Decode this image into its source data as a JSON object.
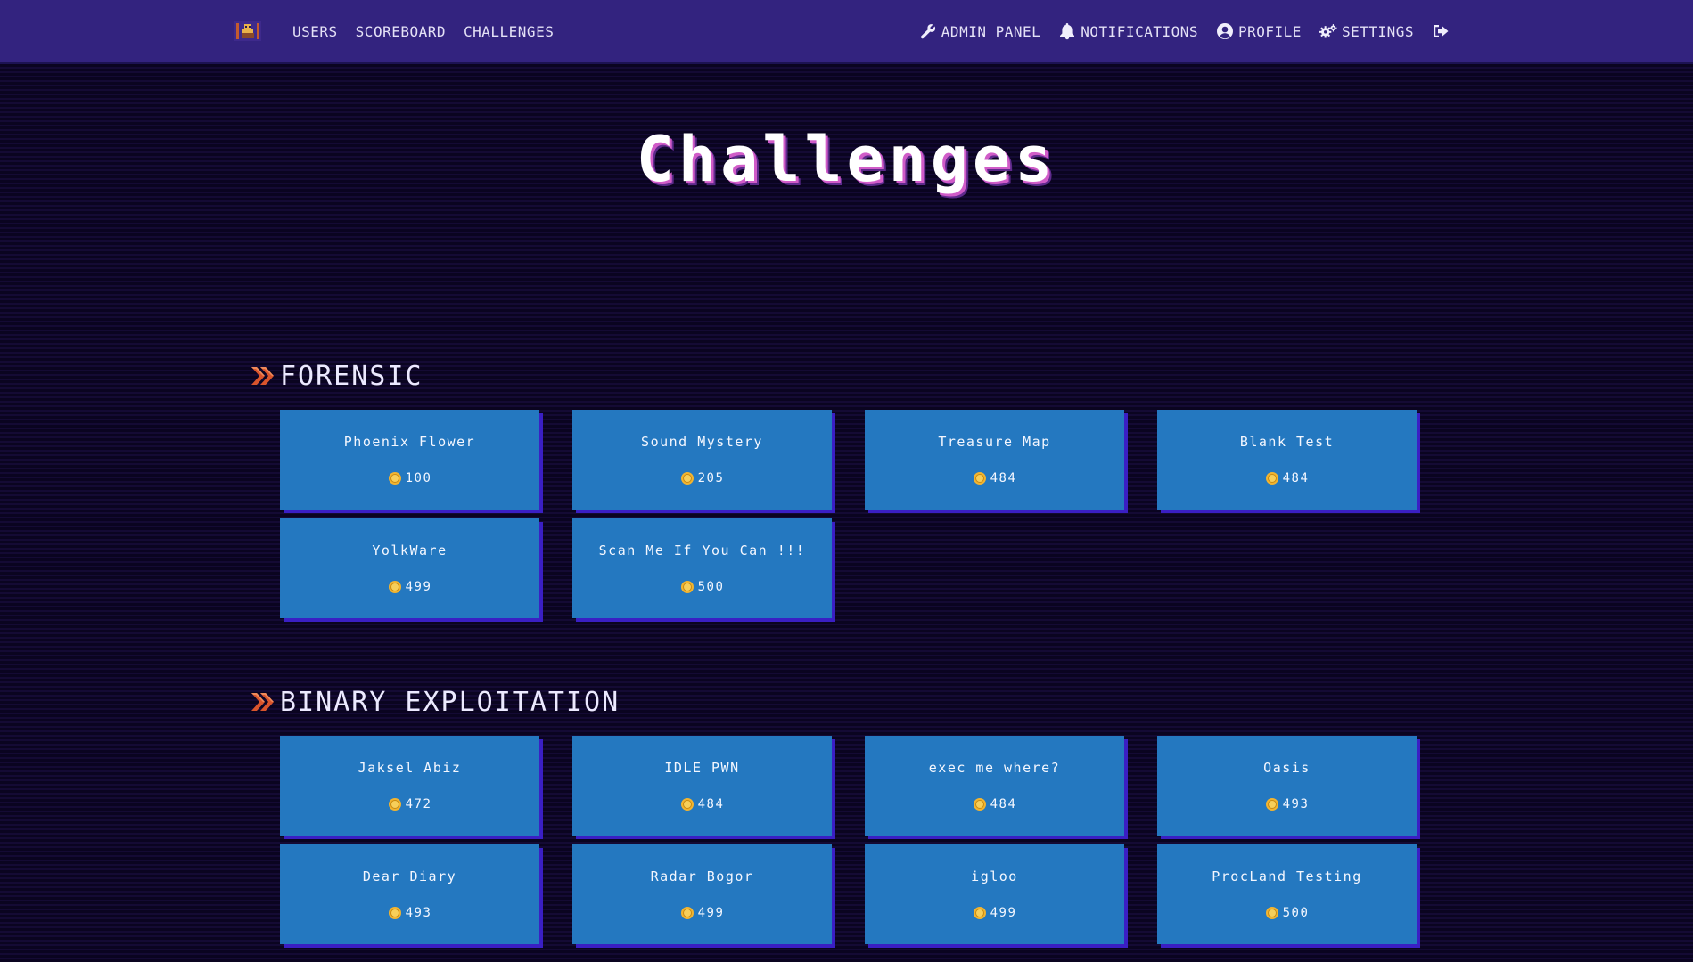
{
  "navbar": {
    "left_links": [
      {
        "label": "USERS",
        "icon": "none"
      },
      {
        "label": "SCOREBOARD",
        "icon": "none"
      },
      {
        "label": "CHALLENGES",
        "icon": "none"
      }
    ],
    "right_links": [
      {
        "label": "ADMIN PANEL",
        "icon": "wrench-icon"
      },
      {
        "label": "NOTIFICATIONS",
        "icon": "bell-icon"
      },
      {
        "label": "PROFILE",
        "icon": "user-circle-icon"
      },
      {
        "label": "SETTINGS",
        "icon": "gears-icon"
      },
      {
        "label": "",
        "icon": "logout-icon"
      }
    ],
    "brand_icon": "ctf-logo"
  },
  "page": {
    "title": "Challenges"
  },
  "colors": {
    "navbar": "#33237f",
    "background": "#0a0420",
    "card": "#2478c0",
    "card_shadow": "#3a1fc4",
    "category_arrow": "#d9542c",
    "coin": "#f2b430"
  },
  "categories": [
    {
      "name": "FORENSIC",
      "icon": "double-chevron-right-icon",
      "challenges": [
        {
          "name": "Phoenix Flower",
          "points": "100"
        },
        {
          "name": "Sound Mystery",
          "points": "205"
        },
        {
          "name": "Treasure Map",
          "points": "484"
        },
        {
          "name": "Blank Test",
          "points": "484"
        },
        {
          "name": "YolkWare",
          "points": "499"
        },
        {
          "name": "Scan Me If You Can !!!",
          "points": "500"
        }
      ]
    },
    {
      "name": "BINARY EXPLOITATION",
      "icon": "double-chevron-right-icon",
      "challenges": [
        {
          "name": "Jaksel Abiz",
          "points": "472"
        },
        {
          "name": "IDLE PWN",
          "points": "484"
        },
        {
          "name": "exec me where?",
          "points": "484"
        },
        {
          "name": "Oasis",
          "points": "493"
        },
        {
          "name": "Dear Diary",
          "points": "493"
        },
        {
          "name": "Radar Bogor",
          "points": "499"
        },
        {
          "name": "igloo",
          "points": "499"
        },
        {
          "name": "ProcLand Testing",
          "points": "500"
        }
      ]
    }
  ]
}
